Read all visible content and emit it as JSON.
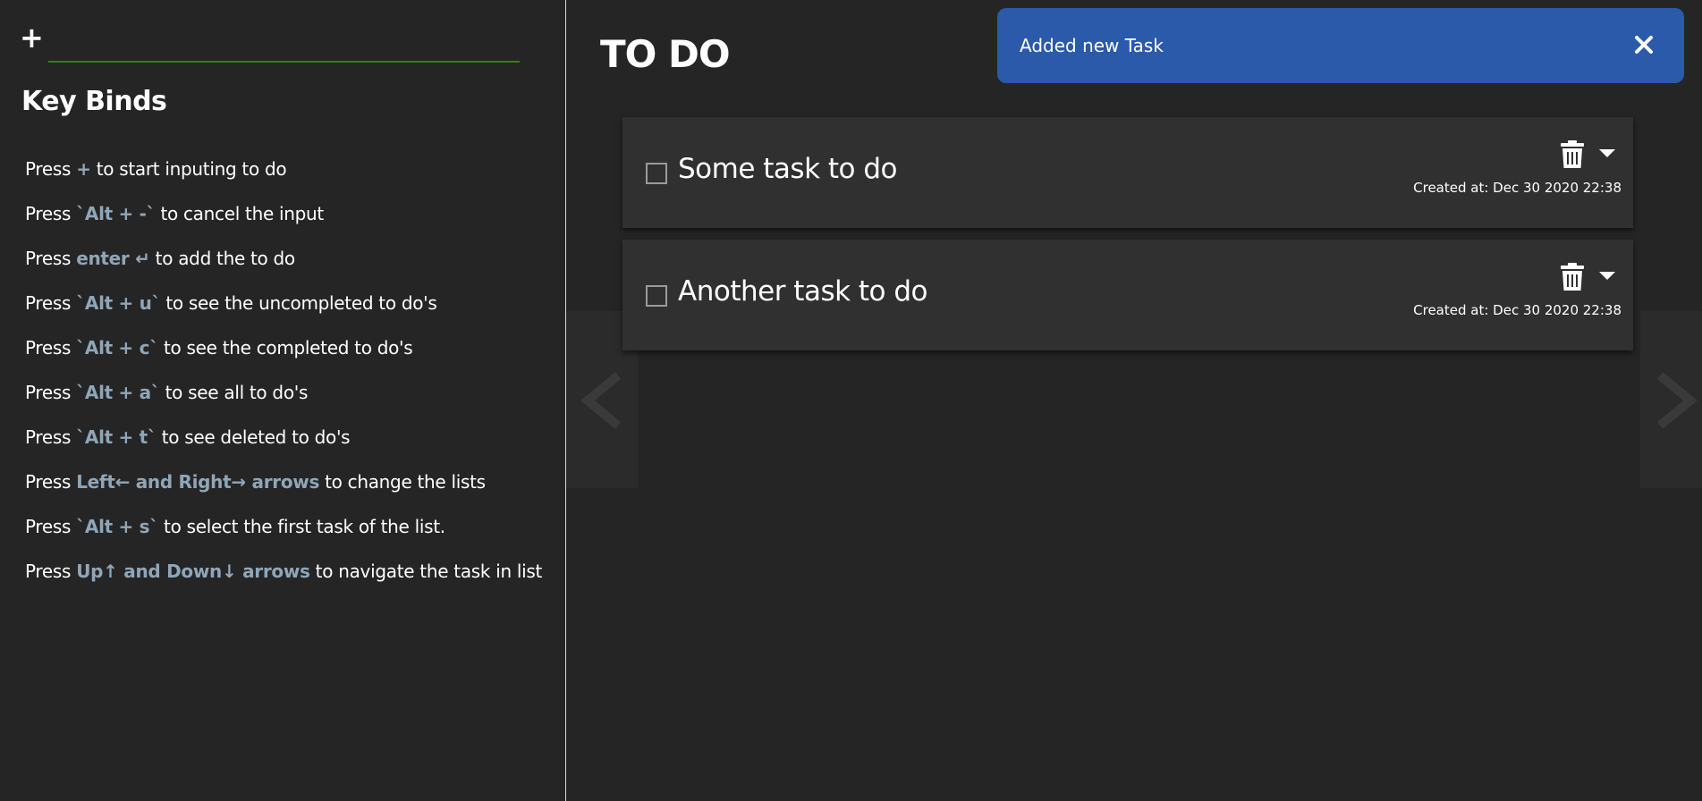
{
  "sidebar": {
    "add_button_label": "+",
    "input_placeholder": "",
    "key_binds_title": "Key Binds",
    "key_binds": [
      {
        "prefix": "Press ",
        "key": "+",
        "suffix": " to start inputing to do"
      },
      {
        "prefix": "Press ",
        "key": "`Alt + -`",
        "suffix": " to cancel the input"
      },
      {
        "prefix": "Press ",
        "key": "enter ↵",
        "suffix": " to add the to do"
      },
      {
        "prefix": "Press ",
        "key": "`Alt + u`",
        "suffix": " to see the uncompleted to do's"
      },
      {
        "prefix": "Press ",
        "key": "`Alt + c`",
        "suffix": " to see the completed to do's"
      },
      {
        "prefix": "Press ",
        "key": "`Alt + a`",
        "suffix": " to see all to do's"
      },
      {
        "prefix": "Press ",
        "key": "`Alt + t`",
        "suffix": " to see deleted to do's"
      },
      {
        "prefix": "Press ",
        "key": "Left← and Right→ arrows",
        "suffix": " to change the lists"
      },
      {
        "prefix": "Press ",
        "key": "`Alt + s`",
        "suffix": " to select the first task of the list."
      },
      {
        "prefix": "Press ",
        "key": "Up↑ and Down↓ arrows",
        "suffix": " to navigate the task in list"
      }
    ]
  },
  "main": {
    "title": "TO DO",
    "tasks": [
      {
        "text": "Some task to do",
        "created": "Created at: Dec 30 2020 22:38",
        "completed": false
      },
      {
        "text": "Another task to do",
        "created": "Created at: Dec 30 2020 22:38",
        "completed": false
      }
    ]
  },
  "toast": {
    "message": "Added new Task"
  },
  "icons": {
    "add": "plus-icon",
    "delete": "trash-icon",
    "expand": "chevron-down-icon",
    "close": "close-icon",
    "prev": "chevron-left-icon",
    "next": "chevron-right-icon"
  },
  "colors": {
    "background": "#252525",
    "card": "#303030",
    "accent_key": "#8fa6b8",
    "input_underline": "#1a8a1a",
    "toast": "#2b5aab"
  }
}
